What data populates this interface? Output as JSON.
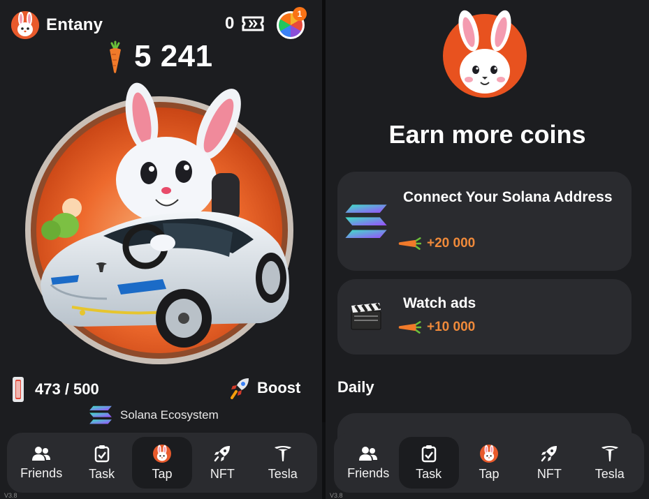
{
  "left": {
    "username": "Entany",
    "tickets": "0",
    "wheel_badge": "1",
    "balance": "5 241",
    "energy": "473 / 500",
    "boost_label": "Boost",
    "ecosystem_label": "Solana Ecosystem",
    "version": "V3.8"
  },
  "right": {
    "headline": "Earn more coins",
    "tasks": [
      {
        "title": "Connect Your Solana Address",
        "reward": "+20 000",
        "icon": "solana-icon"
      },
      {
        "title": "Watch ads",
        "reward": "+10 000",
        "icon": "clapperboard-icon"
      }
    ],
    "daily_label": "Daily",
    "version": "V3.8"
  },
  "nav": {
    "items": [
      "Friends",
      "Task",
      "Tap",
      "NFT",
      "Tesla"
    ],
    "left_active": "Tap",
    "right_active": "Task"
  },
  "colors": {
    "background": "#1c1d20",
    "card": "#2a2b2f",
    "accent": "#f08a3a",
    "brand_orange": "#e85a2c"
  }
}
